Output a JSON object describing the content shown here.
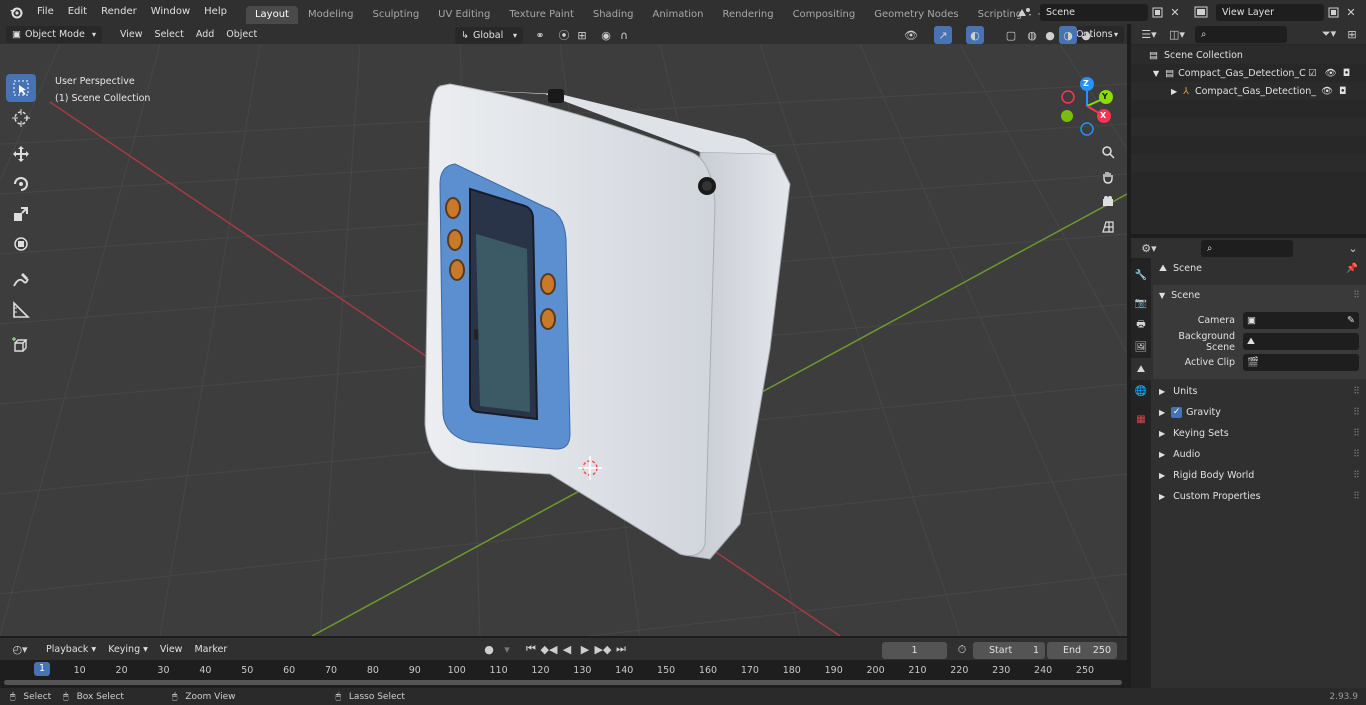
{
  "menu": {
    "items": [
      "File",
      "Edit",
      "Render",
      "Window",
      "Help"
    ]
  },
  "workspaces": {
    "tabs": [
      "Layout",
      "Modeling",
      "Sculpting",
      "UV Editing",
      "Texture Paint",
      "Shading",
      "Animation",
      "Rendering",
      "Compositing",
      "Geometry Nodes",
      "Scripting"
    ],
    "active": "Layout",
    "add_symbol": "+"
  },
  "scene_selector": {
    "value": "Scene"
  },
  "view_layer_selector": {
    "value": "View Layer"
  },
  "viewport_header": {
    "mode": "Object Mode",
    "menus": [
      "View",
      "Select",
      "Add",
      "Object"
    ],
    "transform_orientation": "Global",
    "options_label": "Options"
  },
  "viewport": {
    "perspective_label": "User Perspective",
    "collection_label": "(1) Scene Collection",
    "gizmo_axes": {
      "z": "Z",
      "y": "Y",
      "x": "X"
    }
  },
  "outliner": {
    "root": "Scene Collection",
    "items": [
      {
        "label": "Compact_Gas_Detection_Con",
        "level": 1
      },
      {
        "label": "Compact_Gas_Detection_",
        "level": 2
      }
    ]
  },
  "properties": {
    "header": "Scene",
    "panel_title": "Scene",
    "fields": [
      {
        "label": "Camera",
        "value": ""
      },
      {
        "label": "Background Scene",
        "value": ""
      },
      {
        "label": "Active Clip",
        "value": ""
      }
    ],
    "collapsed_panels": [
      "Units",
      "Gravity",
      "Keying Sets",
      "Audio",
      "Rigid Body World",
      "Custom Properties"
    ],
    "gravity_checked": true
  },
  "timeline": {
    "menus": [
      "Playback",
      "Keying",
      "View",
      "Marker"
    ],
    "current_frame": "1",
    "start_label": "Start",
    "start_value": "1",
    "end_label": "End",
    "end_value": "250",
    "ruler_frames": [
      "1",
      "10",
      "20",
      "30",
      "40",
      "50",
      "60",
      "70",
      "80",
      "90",
      "100",
      "110",
      "120",
      "130",
      "140",
      "150",
      "160",
      "170",
      "180",
      "190",
      "200",
      "210",
      "220",
      "230",
      "240",
      "250"
    ]
  },
  "statusbar": {
    "items": [
      "Select",
      "Box Select",
      "Zoom View",
      "Lasso Select"
    ],
    "version": "2.93.9"
  },
  "colors": {
    "accent": "#4772b3",
    "x_axis": "#ff3352",
    "y_axis": "#8bdc00",
    "z_axis": "#2890ff",
    "device_body": "#d7dce3",
    "device_panel": "#5b8fd0",
    "led_orange": "#c87a2a"
  }
}
